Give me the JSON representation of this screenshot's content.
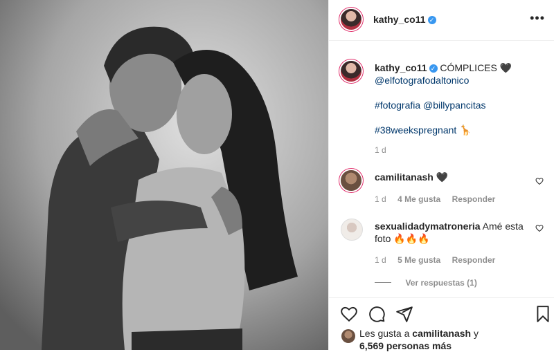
{
  "post": {
    "author": "kathy_co11",
    "caption_title": "CÓMPLICES 🖤",
    "mention_photographer": "@elfotografodaltonico",
    "tag_fotografia": "#fotografia",
    "mention_billy": "@billypancitas",
    "tag_weeks": "#38weekspregnant",
    "weeks_emoji": "🦒",
    "time": "1 d"
  },
  "comments": [
    {
      "user": "camilitanash",
      "text": "🖤",
      "time": "1 d",
      "likes": "4 Me gusta",
      "reply": "Responder"
    },
    {
      "user": "sexualidadymatroneria",
      "text": "Amé esta foto 🔥🔥🔥",
      "time": "1 d",
      "likes": "5 Me gusta",
      "reply": "Responder",
      "view_replies": "Ver respuestas (1)"
    }
  ],
  "likes": {
    "prefix": "Les gusta a",
    "user": "camilitanash",
    "conj": "y",
    "count": "6,569 personas más"
  },
  "colors": {
    "verified": "#3897f0",
    "link": "#00376b",
    "muted": "#8e8e8e",
    "story_ring": "#e1306c"
  },
  "icons": [
    "more-options-icon",
    "verified-icon",
    "heart-icon",
    "comment-icon",
    "share-icon",
    "bookmark-icon"
  ]
}
